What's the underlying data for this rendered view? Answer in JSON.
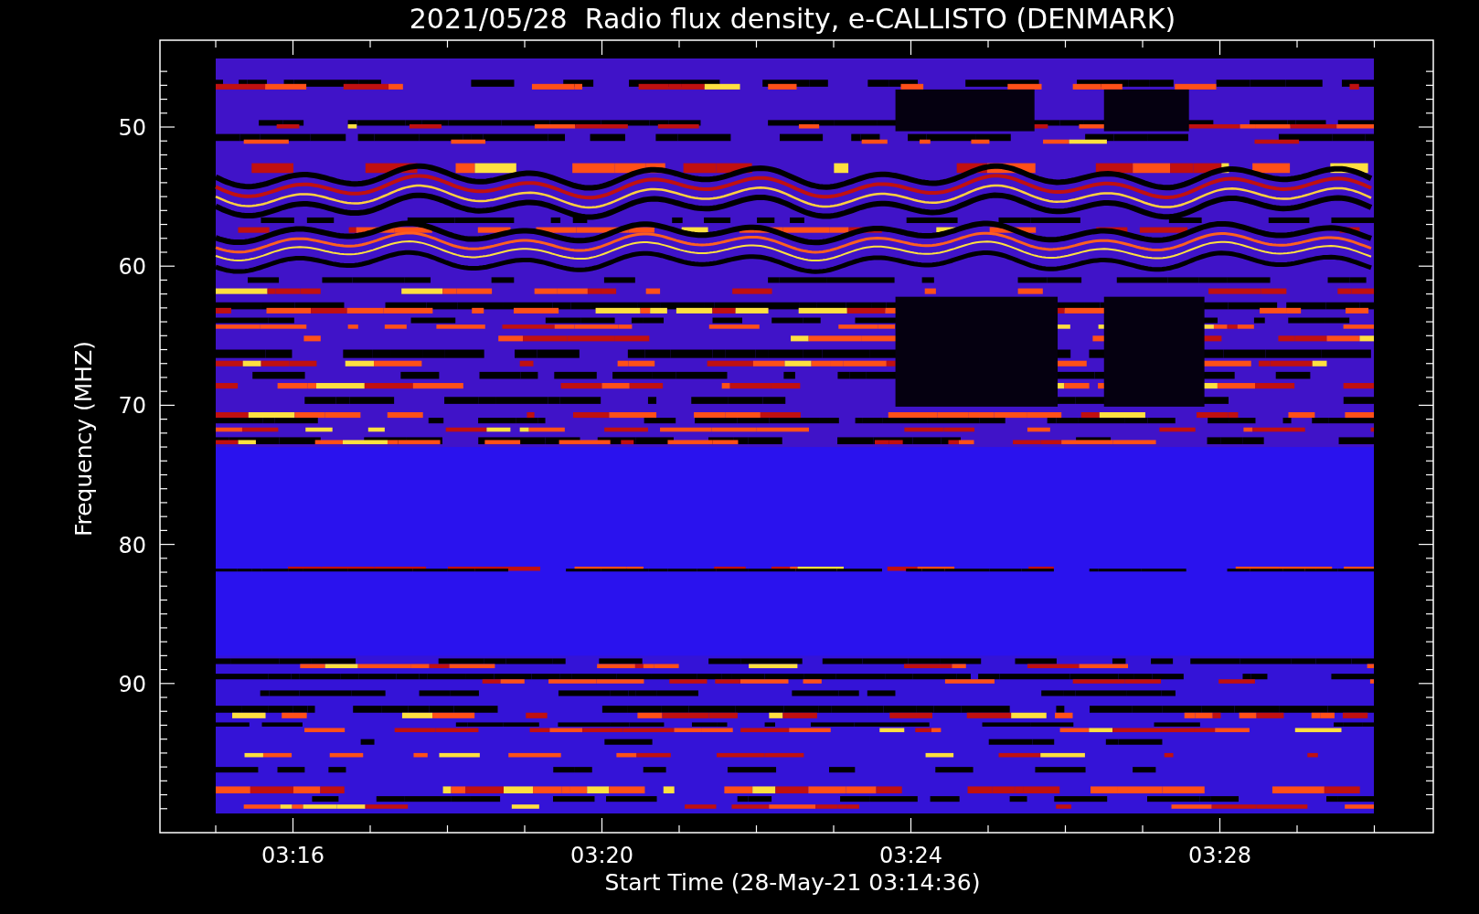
{
  "title": "2021/05/28  Radio flux density, e-CALLISTO (DENMARK)",
  "y_axis": {
    "label": "Frequency (MHZ)",
    "ticks": [
      "50",
      "60",
      "70",
      "80",
      "90"
    ]
  },
  "x_axis": {
    "label": "Start Time (28-May-21 03:14:36)",
    "ticks": [
      "03:16",
      "03:20",
      "03:24",
      "03:28"
    ]
  }
}
